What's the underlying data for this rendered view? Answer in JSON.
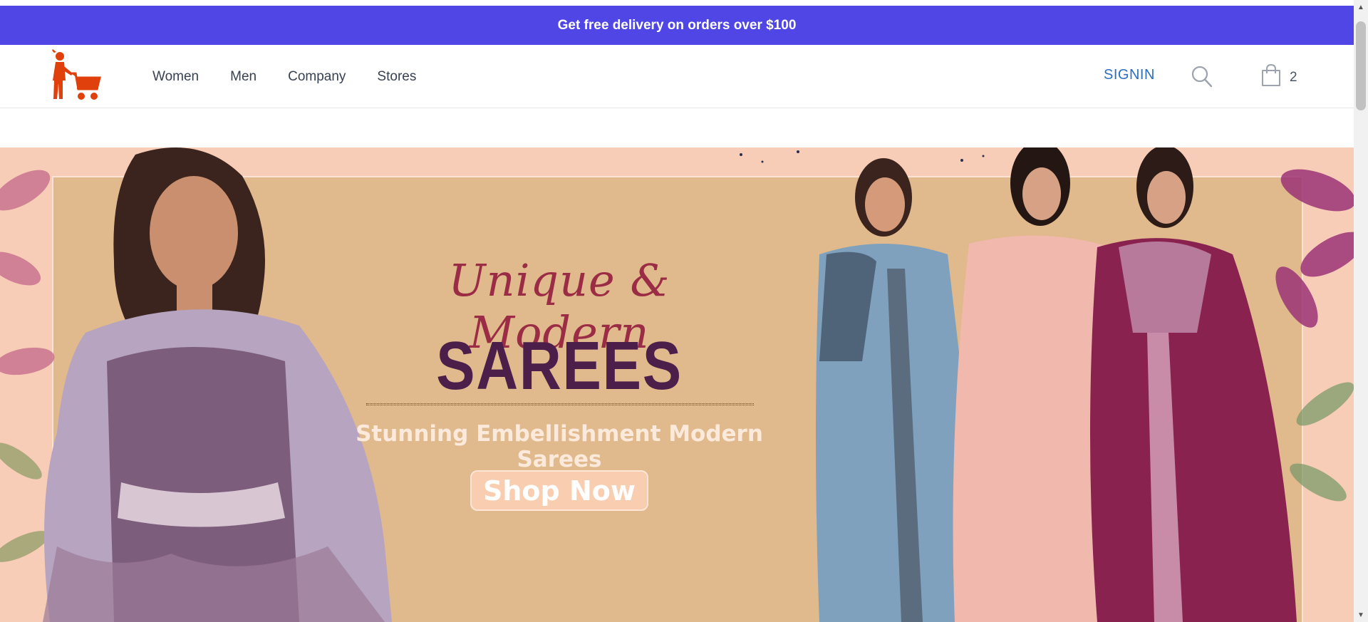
{
  "promo": {
    "text": "Get free delivery on orders over $100"
  },
  "nav": {
    "items": [
      {
        "label": "Women"
      },
      {
        "label": "Men"
      },
      {
        "label": "Company"
      },
      {
        "label": "Stores"
      }
    ]
  },
  "header": {
    "signin_label": "SIGNIN",
    "cart_count": "2",
    "search_icon": "search-icon",
    "cart_icon": "shopping-bag-icon",
    "logo_icon": "shopper-cart-logo"
  },
  "hero": {
    "script_title": "Unique & Modern",
    "big_title": "SAREES",
    "tagline": "Stunning Embellishment Modern Sarees",
    "cta_label": "Shop Now"
  },
  "colors": {
    "promo_bg": "#4f46e5",
    "signin": "#2d6fbf",
    "logo": "#e0400b",
    "hero_bg": "#e0b98c",
    "hero_border": "#f8cdb8",
    "script_title": "#9b2c45",
    "big_title": "#4b1f4a"
  }
}
